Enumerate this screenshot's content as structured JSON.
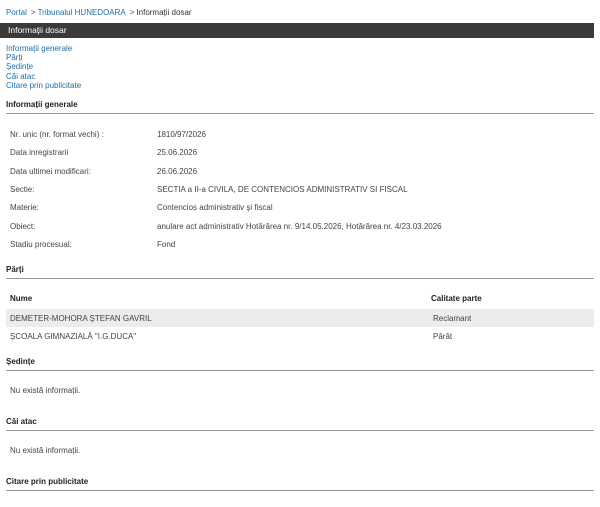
{
  "breadcrumb": {
    "portal": "Portal",
    "court": "Tribunalul HUNEDOARA",
    "current": "Informații dosar",
    "separator": ">"
  },
  "title": "Informații dosar",
  "nav_links": [
    "Informații generale",
    "Părți",
    "Ședințe",
    "Căi atac",
    "Citare prin publicitate"
  ],
  "general": {
    "heading": "Informații generale",
    "fields": [
      {
        "label": "Nr. unic (nr. format vechi) :",
        "value": "1810/97/2026"
      },
      {
        "label": "Data inregistrarii",
        "value": "25.06.2026"
      },
      {
        "label": "Data ultimei modificari:",
        "value": "26.06.2026"
      },
      {
        "label": "Sectie:",
        "value": "SECTIA a II-a CIVILA, DE CONTENCIOS ADMINISTRATIV SI FISCAL"
      },
      {
        "label": "Materie:",
        "value": "Contencios administrativ și fiscal"
      },
      {
        "label": "Obiect:",
        "value": "anulare act administrativ Hotărârea nr. 9/14.05.2026, Hotărârea nr. 4/23.03.2026"
      },
      {
        "label": "Stadiu procesual:",
        "value": "Fond"
      }
    ]
  },
  "parti": {
    "heading": "Părți",
    "columns": {
      "name": "Nume",
      "role": "Calitate parte"
    },
    "rows": [
      {
        "name": "DEMETER-MOHORA ȘTEFAN GAVRIL",
        "role": "Reclamant"
      },
      {
        "name": "ȘCOALA GIMNAZIALĂ \"I.G.DUCA\"",
        "role": "Pârât"
      }
    ]
  },
  "sedinte": {
    "heading": "Ședințe",
    "empty": "Nu există informații."
  },
  "cai_atac": {
    "heading": "Căi atac",
    "empty": "Nu există informații."
  },
  "citare": {
    "heading": "Citare prin publicitate"
  }
}
